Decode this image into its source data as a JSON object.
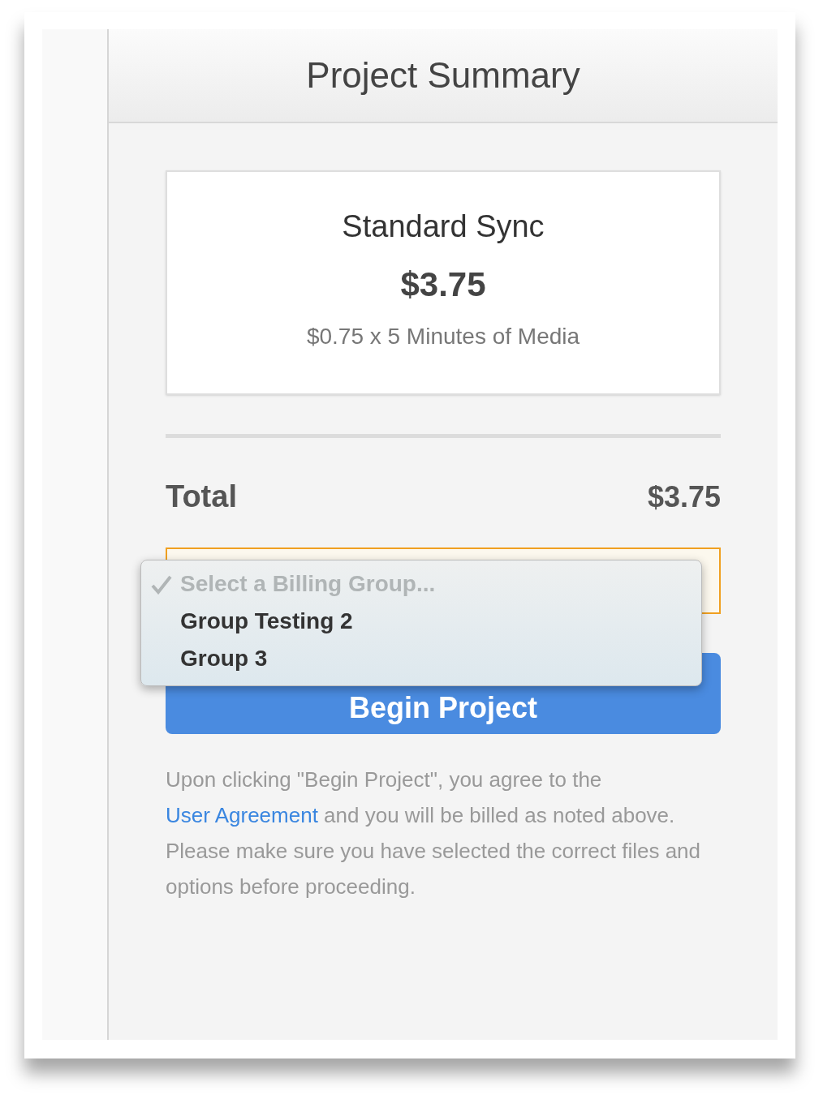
{
  "header": {
    "title": "Project Summary"
  },
  "plan_card": {
    "name": "Standard Sync",
    "price": "$3.75",
    "breakdown": "$0.75 x 5 Minutes of Media"
  },
  "total": {
    "label": "Total",
    "amount": "$3.75"
  },
  "billing_select": {
    "expanded": true,
    "options": [
      {
        "label": "Select a Billing Group...",
        "selected": true,
        "disabled": true
      },
      {
        "label": "Group Testing 2",
        "selected": false,
        "disabled": false
      },
      {
        "label": "Group 3",
        "selected": false,
        "disabled": false
      }
    ]
  },
  "begin_button": {
    "label": "Begin Project"
  },
  "notice": {
    "before": "Upon clicking \"Begin Project\", you agree to the ",
    "link": "User Agreement",
    "after": " and you will be billed as noted above. Please make sure you have selected the correct files and options before proceeding."
  }
}
